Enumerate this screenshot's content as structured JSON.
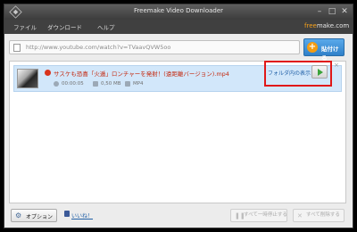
{
  "window": {
    "title": "Freemake Video Downloader"
  },
  "menu": {
    "file": "ファイル",
    "download": "ダウンロード",
    "help": "ヘルプ"
  },
  "brand": {
    "prefix": "free",
    "suffix": "make.com",
    "accent_color": "#f7a21b"
  },
  "url_bar": {
    "value": "http://www.youtube.com/watch?v=TVaavQVW5oo"
  },
  "paste_button": {
    "label": "貼付ける",
    "icon": "plus-icon"
  },
  "downloads": [
    {
      "title": "サスケも恐喜「火遁」ロンチャーを発射！(遠距離バージョン).mp4",
      "duration": "00:00:05",
      "size": "0,50 MB",
      "format": "MP4",
      "folder_link": "フォルダ内の表示"
    }
  ],
  "footer": {
    "options_label": "オプション",
    "like_label": "いいね！",
    "pause_all_label": "すべて一時停止する",
    "delete_all_label": "すべて削除する"
  },
  "colors": {
    "highlight": "#e01818",
    "selected_row": "#d2e7fa",
    "button_blue": "#2f80c9"
  }
}
